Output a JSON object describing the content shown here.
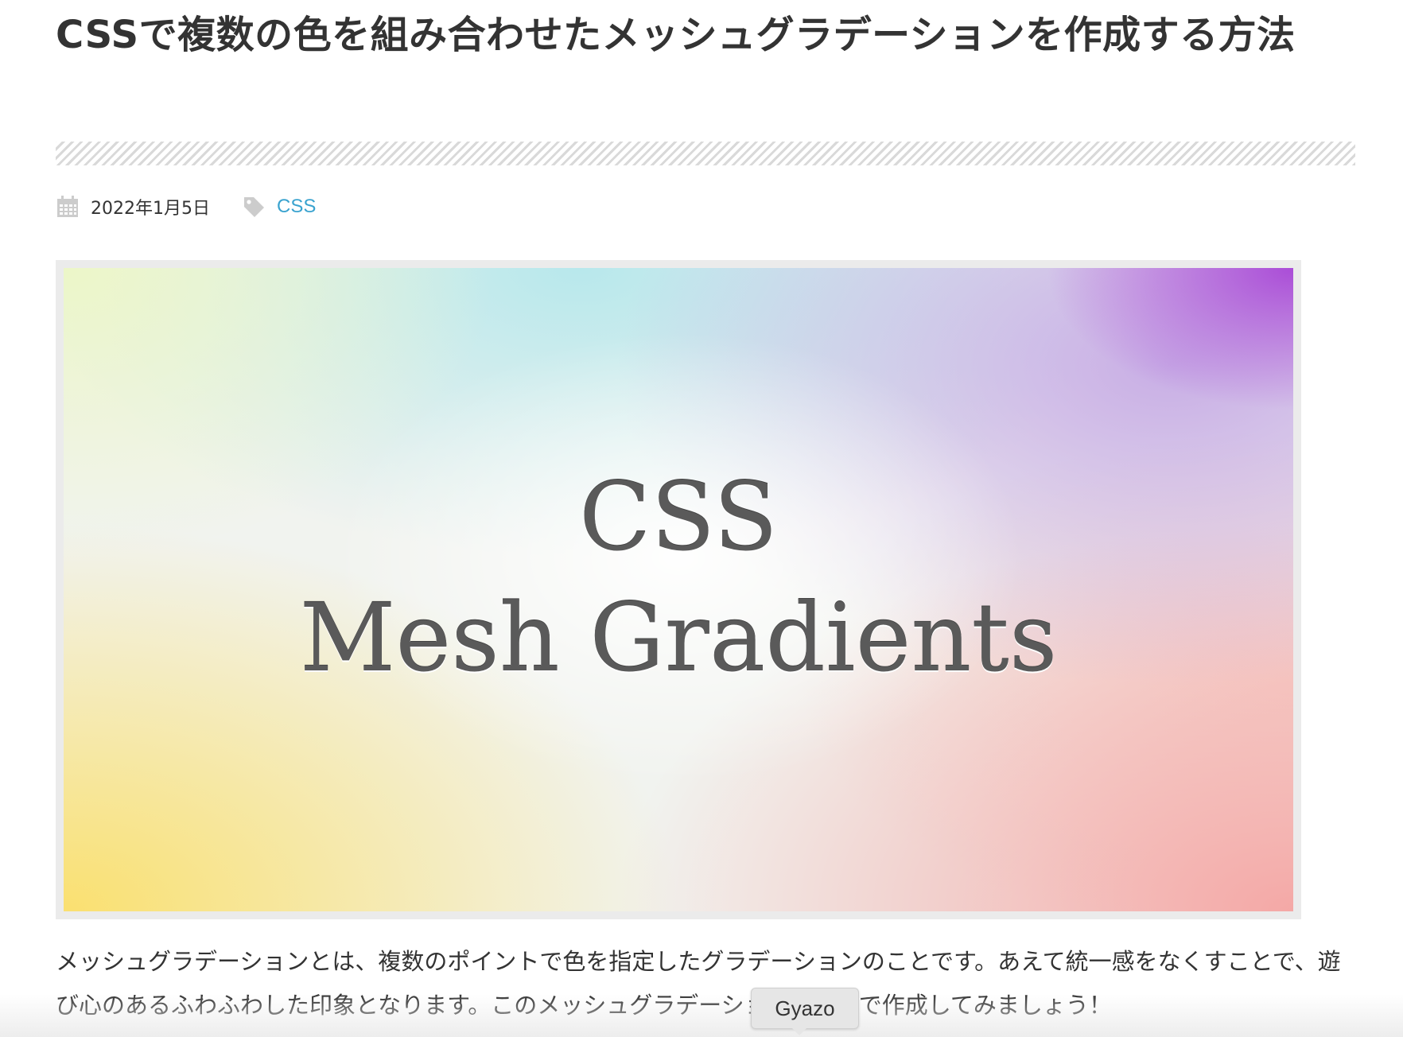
{
  "article": {
    "title": "CSSで複数の色を組み合わせたメッシュグラデーションを作成する方法",
    "date_icon": "calendar-icon",
    "date": "2022年1月5日",
    "category_icon": "tag-icon",
    "category": "CSS",
    "link_color": "#3aa3cf"
  },
  "hero": {
    "line1": "CSS",
    "line2": "Mesh Gradients",
    "colors": {
      "top_left": "#ecf6c8",
      "top_center": "#b8e8ec",
      "top_right": "#a846d6",
      "bottom_left": "#fae070",
      "bottom_right": "#f4a8a6",
      "center": "#ffffff"
    }
  },
  "body": {
    "paragraph": "メッシュグラデーションとは、複数のポイントで色を指定したグラデーションのことです。あえて統一感をなくすことで、遊び心のあるふわふわした印象となります。このメッシュグラデーションをCSSで作成してみましょう！"
  },
  "tooltip": {
    "label": "Gyazo"
  }
}
